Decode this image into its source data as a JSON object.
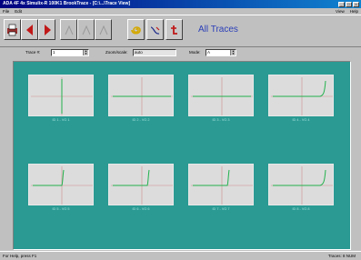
{
  "window": {
    "title": "ADA 4F 4x Simulix-R 100K1 BrookTrace - [C:\\...\\Trace View]",
    "controls": [
      "_",
      "□",
      "×"
    ]
  },
  "menubar": {
    "items": [
      "File",
      "Edit"
    ],
    "right_items": [
      "View",
      "Help"
    ]
  },
  "toolbar": {
    "view_title": "All Traces",
    "buttons": [
      {
        "name": "print-icon",
        "enabled": true
      },
      {
        "name": "prev-icon",
        "enabled": true
      },
      {
        "name": "next-icon",
        "enabled": true
      },
      {
        "name": "tool-icon",
        "enabled": false
      },
      {
        "name": "tool-icon",
        "enabled": false
      },
      {
        "name": "tool-icon",
        "enabled": false
      },
      {
        "name": "spiral-icon",
        "enabled": true
      },
      {
        "name": "curve-icon",
        "enabled": true
      },
      {
        "name": "reset-icon",
        "enabled": true
      }
    ]
  },
  "controls": {
    "field1_label": "Trace #:",
    "field1_value": "1",
    "field2_label": "Zoom/scale:",
    "field2_value": "auto",
    "field3_label": "Mode:",
    "field3_value": "A"
  },
  "traces": [
    {
      "caption": "ID 1 - VG 1",
      "shape": "vertical"
    },
    {
      "caption": "ID 2 - VG 2",
      "shape": "flat"
    },
    {
      "caption": "ID 3 - VG 3",
      "shape": "flat"
    },
    {
      "caption": "ID 4 - VG 4",
      "shape": "rise-right"
    },
    {
      "caption": "ID 5 - VG 5",
      "shape": "rise-center"
    },
    {
      "caption": "ID 6 - VG 6",
      "shape": "rise-right-center"
    },
    {
      "caption": "ID 7 - VG 7",
      "shape": "rise-right-center"
    },
    {
      "caption": "ID 8 - VG 8",
      "shape": "rise-right"
    }
  ],
  "status": {
    "left": "For Help, press F1",
    "right": "Traces: 8   NUM"
  },
  "colors": {
    "background": "#2a9a93",
    "plot_bg": "#dcdcdc",
    "trace": "#22b14c",
    "axis": "#d08a8a",
    "title_text": "#2b3fb8"
  }
}
